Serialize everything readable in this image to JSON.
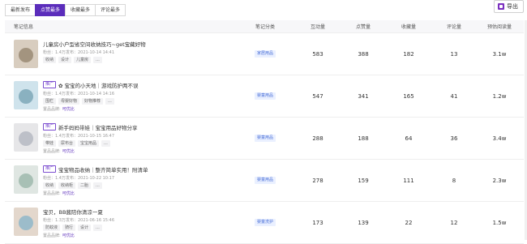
{
  "tabs": [
    "最新发布",
    "点赞最多",
    "收藏最多",
    "评论最多"
  ],
  "active_tab": 1,
  "export_label": "导出",
  "columns": {
    "info": "笔记信息",
    "category": "笔记分类",
    "interactions": "互动量",
    "likes": "点赞量",
    "favorites": "收藏量",
    "comments": "评论量",
    "est_reads": "预估阅读量"
  },
  "goods_label": "置品品牌:",
  "rows": [
    {
      "ad": "",
      "title": "儿童房小户型省空间收纳技巧~get宝藏好物",
      "sub": "粉丝：1.4万发布：2021-10-14 14:41",
      "tags": [
        "收纳",
        "设计",
        "儿童房",
        "..."
      ],
      "goods": "",
      "category": "家居用品",
      "interactions": "583",
      "likes": "388",
      "favorites": "182",
      "comments": "13",
      "reads": "3.1w",
      "colors": [
        "#d8cdbf",
        "#9a8a73"
      ]
    },
    {
      "ad": "推广",
      "title": "✿ 宝宝的小天地｜游戏防护两不误",
      "sub": "粉丝：1.4万发布：2021-10-14 14:16",
      "tags": [
        "围栏",
        "母婴好物",
        "好物推荐",
        "..."
      ],
      "goods": "可优比",
      "category": "婴童用品",
      "interactions": "547",
      "likes": "341",
      "favorites": "165",
      "comments": "41",
      "reads": "1.2w",
      "colors": [
        "#cfe3ec",
        "#7ea8b8"
      ]
    },
    {
      "ad": "推广",
      "title": "新手妈妈带娃｜宝宝用品好物分享",
      "sub": "粉丝：1.4万发布：2021-10-15 16:47",
      "tags": [
        "带娃",
        "尿布台",
        "宝宝用品",
        "..."
      ],
      "goods": "可优比",
      "category": "婴童用品",
      "interactions": "288",
      "likes": "188",
      "favorites": "64",
      "comments": "36",
      "reads": "3.4w",
      "colors": [
        "#e6e6e8",
        "#b5b9c2"
      ]
    },
    {
      "ad": "推广",
      "title": "宝宝物品收纳｜整齐简单实用！附清单",
      "sub": "粉丝：1.4万发布：2021-10-22 10:17",
      "tags": [
        "收纳",
        "收纳柜",
        "二胎",
        "..."
      ],
      "goods": "可优比",
      "category": "婴童用品",
      "interactions": "278",
      "likes": "159",
      "favorites": "111",
      "comments": "8",
      "reads": "2.3w",
      "colors": [
        "#dfe6e2",
        "#9fb8ad"
      ]
    },
    {
      "ad": "",
      "title": "宝贝，BB酱陪你清凉一夏",
      "sub": "粉丝：1.3万发布：2021-06-16 15:46",
      "tags": [
        "防蚊液",
        "骑行",
        "设计",
        "..."
      ],
      "goods": "可优比",
      "category": "婴童洗护",
      "interactions": "173",
      "likes": "139",
      "favorites": "22",
      "comments": "12",
      "reads": "1.5w",
      "colors": [
        "#e3d7cc",
        "#8fb7c9"
      ]
    }
  ]
}
